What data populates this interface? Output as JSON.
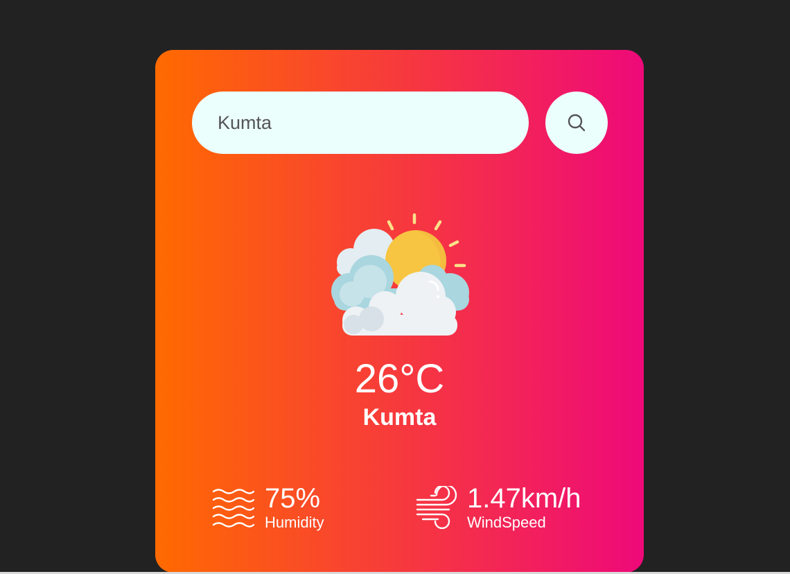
{
  "search": {
    "value": "Kumta",
    "button_icon": "search-icon"
  },
  "weather": {
    "icon": "partly-cloudy-sun-icon",
    "temperature": "26°C",
    "city": "Kumta"
  },
  "details": {
    "humidity": {
      "icon": "humidity-waves-icon",
      "value": "75%",
      "label": "Humidity"
    },
    "wind": {
      "icon": "wind-icon",
      "value": "1.47km/h",
      "label": "WindSpeed"
    }
  },
  "colors": {
    "background": "#222222",
    "gradient_start": "#ff6a00",
    "gradient_end": "#ee0979",
    "input_background": "#ebfffc",
    "text": "#ffffff"
  }
}
